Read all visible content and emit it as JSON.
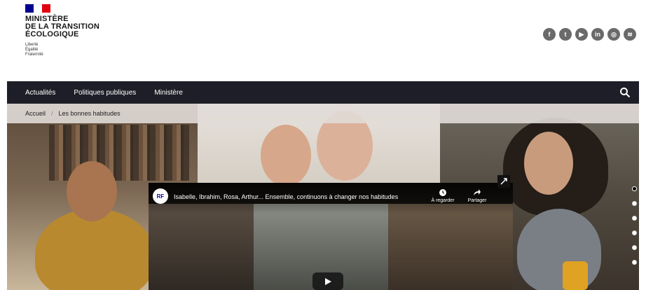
{
  "header": {
    "ministry_lines": [
      "MINISTÈRE",
      "DE LA TRANSITION",
      "ÉCOLOGIQUE"
    ],
    "motto_lines": [
      "Liberté",
      "Égalité",
      "Fraternité"
    ],
    "social": [
      {
        "name": "facebook-icon",
        "glyph": "f"
      },
      {
        "name": "twitter-icon",
        "glyph": "t"
      },
      {
        "name": "youtube-icon",
        "glyph": "▶"
      },
      {
        "name": "linkedin-icon",
        "glyph": "in"
      },
      {
        "name": "instagram-icon",
        "glyph": "◎"
      },
      {
        "name": "rss-icon",
        "glyph": "≋"
      }
    ]
  },
  "nav": {
    "items": [
      "Actualités",
      "Politiques publiques",
      "Ministère"
    ]
  },
  "breadcrumb": {
    "home": "Accueil",
    "current": "Les bonnes habitudes"
  },
  "video": {
    "title": "Isabelle, Ibrahim, Rosa, Arthur... Ensemble, continuons à changer nos habitudes",
    "watch_later": "À regarder",
    "share": "Partager"
  },
  "carousel": {
    "slide_count": 6,
    "active_index": 0
  },
  "colors": {
    "nav_bg": "#1e1e28",
    "flag_blue": "#000091",
    "flag_red": "#e1000f"
  }
}
